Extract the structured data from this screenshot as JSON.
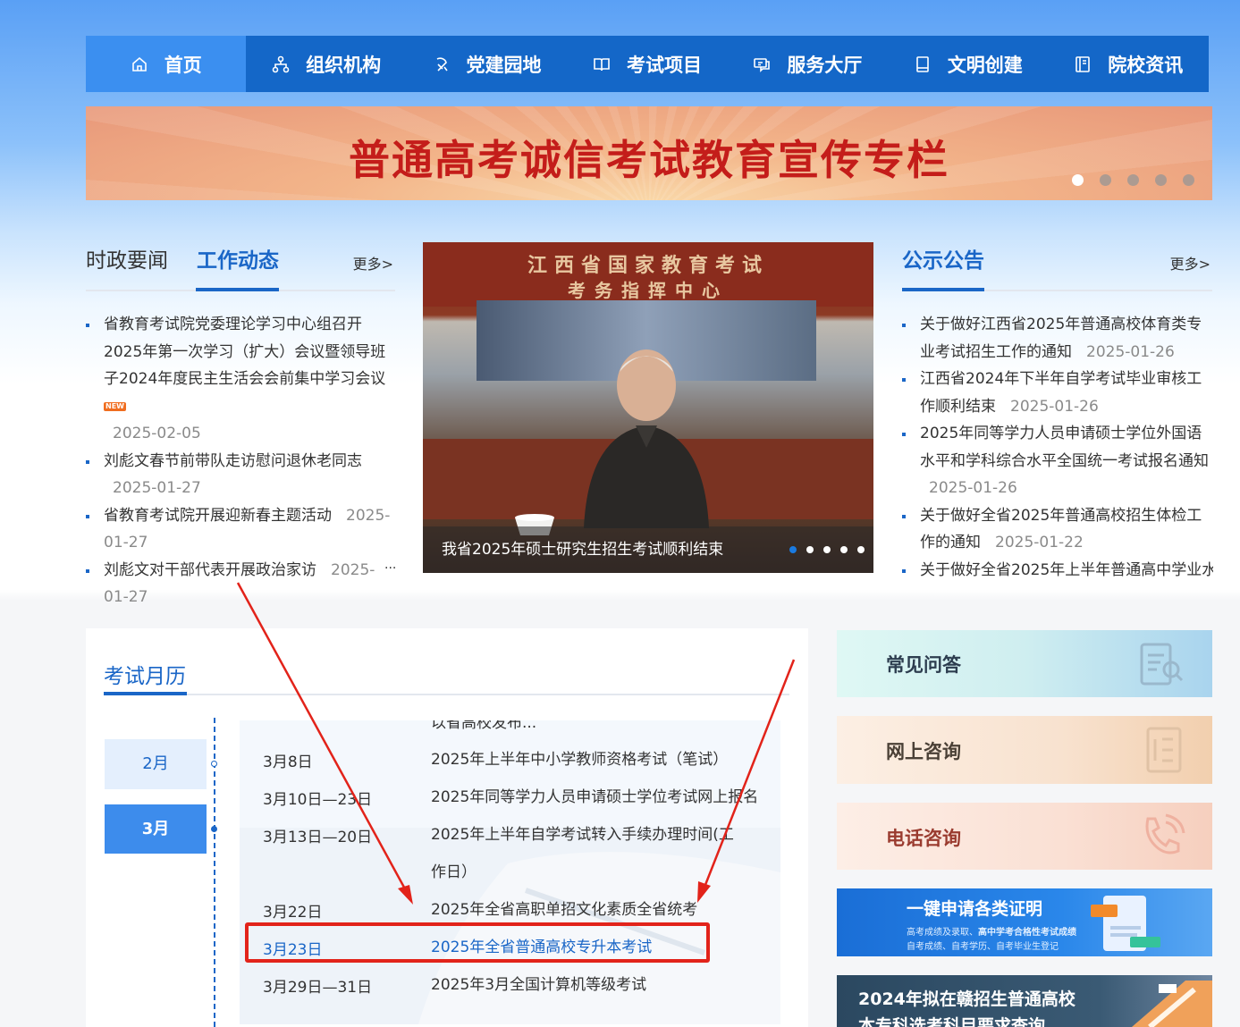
{
  "nav": {
    "items": [
      {
        "label": "首页",
        "icon": "home-icon"
      },
      {
        "label": "组织机构",
        "icon": "org-chart-icon"
      },
      {
        "label": "党建园地",
        "icon": "party-emblem-icon"
      },
      {
        "label": "考试项目",
        "icon": "book-icon"
      },
      {
        "label": "服务大厅",
        "icon": "service-chat-icon"
      },
      {
        "label": "文明创建",
        "icon": "notebook-icon"
      },
      {
        "label": "院校资讯",
        "icon": "document-icon"
      }
    ],
    "active_index": 0
  },
  "banner": {
    "title": "普通高考诚信考试教育宣传专栏",
    "slide_count": 5,
    "active_slide": 0
  },
  "news": {
    "tabs": [
      "时政要闻",
      "工作动态"
    ],
    "active_tab": 1,
    "more": "更多>",
    "items": [
      {
        "title": "省教育考试院党委理论学习中心组召开2025年第一次学习（扩大）会议暨领导班子2024年度民主生活会会前集中学习会议",
        "is_new": true,
        "new_label": "NEW",
        "date": "2025-02-05"
      },
      {
        "title": "刘彪文春节前带队走访慰问退休老同志",
        "date": "2025-01-27"
      },
      {
        "title": "省教育考试院开展迎新春主题活动",
        "date": "2025-01-27"
      },
      {
        "title": "刘彪文对干部代表开展政治家访",
        "date": "2025-01-27"
      }
    ],
    "ellipsis": "..."
  },
  "photo": {
    "sign_line1": "江西省国家教育考试",
    "sign_line2": "考务指挥中心",
    "caption": "我省2025年硕士研究生招生考试顺利结束",
    "slide_count": 5,
    "active_slide": 0
  },
  "notice": {
    "title": "公示公告",
    "more": "更多>",
    "items": [
      {
        "title": "关于做好江西省2025年普通高校体育类专业考试招生工作的通知",
        "date": "2025-01-26"
      },
      {
        "title": "江西省2024年下半年自学考试毕业审核工作顺利结束",
        "date": "2025-01-26"
      },
      {
        "title": "2025年同等学力人员申请硕士学位外国语水平和学科综合水平全国统一考试报名通知",
        "date": "2025-01-26"
      },
      {
        "title": "关于做好全省2025年普通高校招生体检工作的通知",
        "date": "2025-01-22"
      },
      {
        "title": "关于做好全省2025年上半年普通高中学业水",
        "date": ""
      }
    ]
  },
  "calendar": {
    "title": "考试月历",
    "months": [
      "2月",
      "3月"
    ],
    "active_month": 1,
    "partial_top": "以省高校发布...",
    "events": [
      {
        "date": "3月8日",
        "name": "2025年上半年中小学教师资格考试（笔试）"
      },
      {
        "date": "3月10日—23日",
        "name": "2025年同等学力人员申请硕士学位考试网上报名"
      },
      {
        "date": "3月13日—20日",
        "name": "2025年上半年自学考试转入手续办理时间(工作日）"
      },
      {
        "date": "3月22日",
        "name": "2025年全省高职单招文化素质全省统考"
      },
      {
        "date": "3月23日",
        "name": "2025年全省普通高校专升本考试",
        "highlighted": true
      },
      {
        "date": "3月29日—31日",
        "name": "2025年3月全国计算机等级考试"
      }
    ]
  },
  "side": {
    "faq": "常见问答",
    "online": "网上咨询",
    "phone": "电话咨询",
    "cert_title": "一键申请各类证明",
    "cert_line1_a": "高考成绩及录取、",
    "cert_line1_b": "高中学考合格性考试成绩",
    "cert_line2": "自考成绩、自考学历、自考毕业生登记",
    "query_line1": "2024年拟在赣招生普通高校",
    "query_line2": "本专科选考科目要求查询"
  },
  "colors": {
    "nav_bg": "#1467c8",
    "nav_active": "#3b8ff0",
    "accent": "#1a66c7",
    "annotation": "#e2231a"
  }
}
